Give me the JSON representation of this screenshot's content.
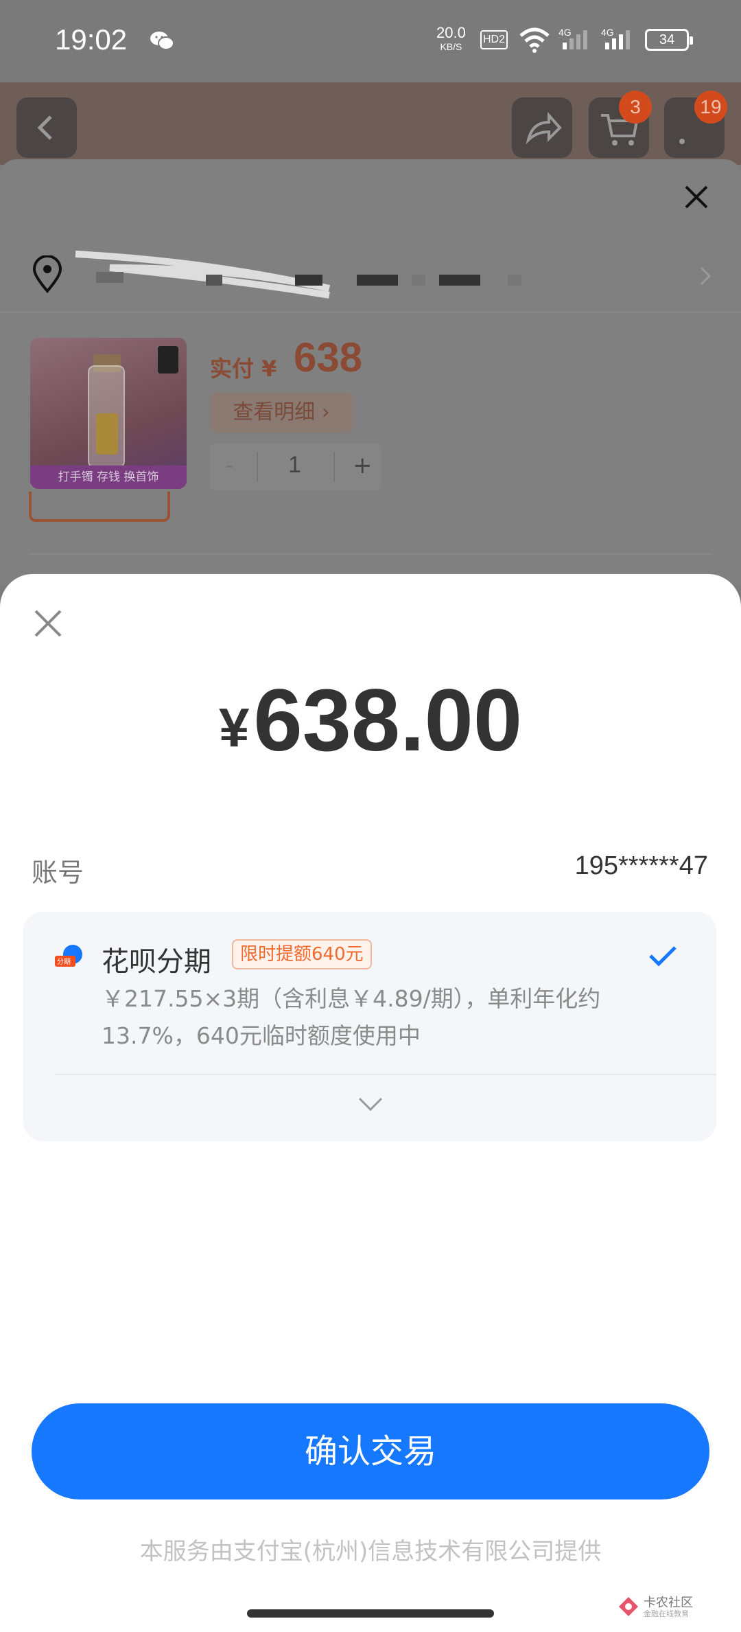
{
  "status_bar": {
    "time": "19:02",
    "net_speed": "20.0",
    "net_unit": "KB/S",
    "hd": "HD2",
    "network_1": "4G",
    "network_2": "4G",
    "battery": "34"
  },
  "product_page": {
    "cart_badge": "3",
    "more_badge": "19",
    "thumb_ribbon": "打手镯 存钱 换首饰",
    "pay_label": "实付 ¥",
    "pay_amount": "638",
    "detail_button": "查看明细 ›",
    "quantity_minus": "-",
    "quantity": "1",
    "quantity_plus": "+"
  },
  "payment": {
    "currency": "¥",
    "amount": "638.00",
    "account_label": "账号",
    "account_value": "195******47",
    "option": {
      "title": "花呗分期",
      "promo": "限时提额640元",
      "description": "￥217.55×3期（含利息￥4.89/期），单利年化约13.7%，640元临时额度使用中",
      "selected": true
    },
    "confirm_button": "确认交易",
    "footer": "本服务由支付宝(杭州)信息技术有限公司提供"
  },
  "watermark": {
    "name": "卡农社区",
    "sub": "金融在线教育"
  },
  "colors": {
    "primary_blue": "#1677ff",
    "promo_orange": "#f06a2e",
    "price_orange": "#e8541f"
  }
}
